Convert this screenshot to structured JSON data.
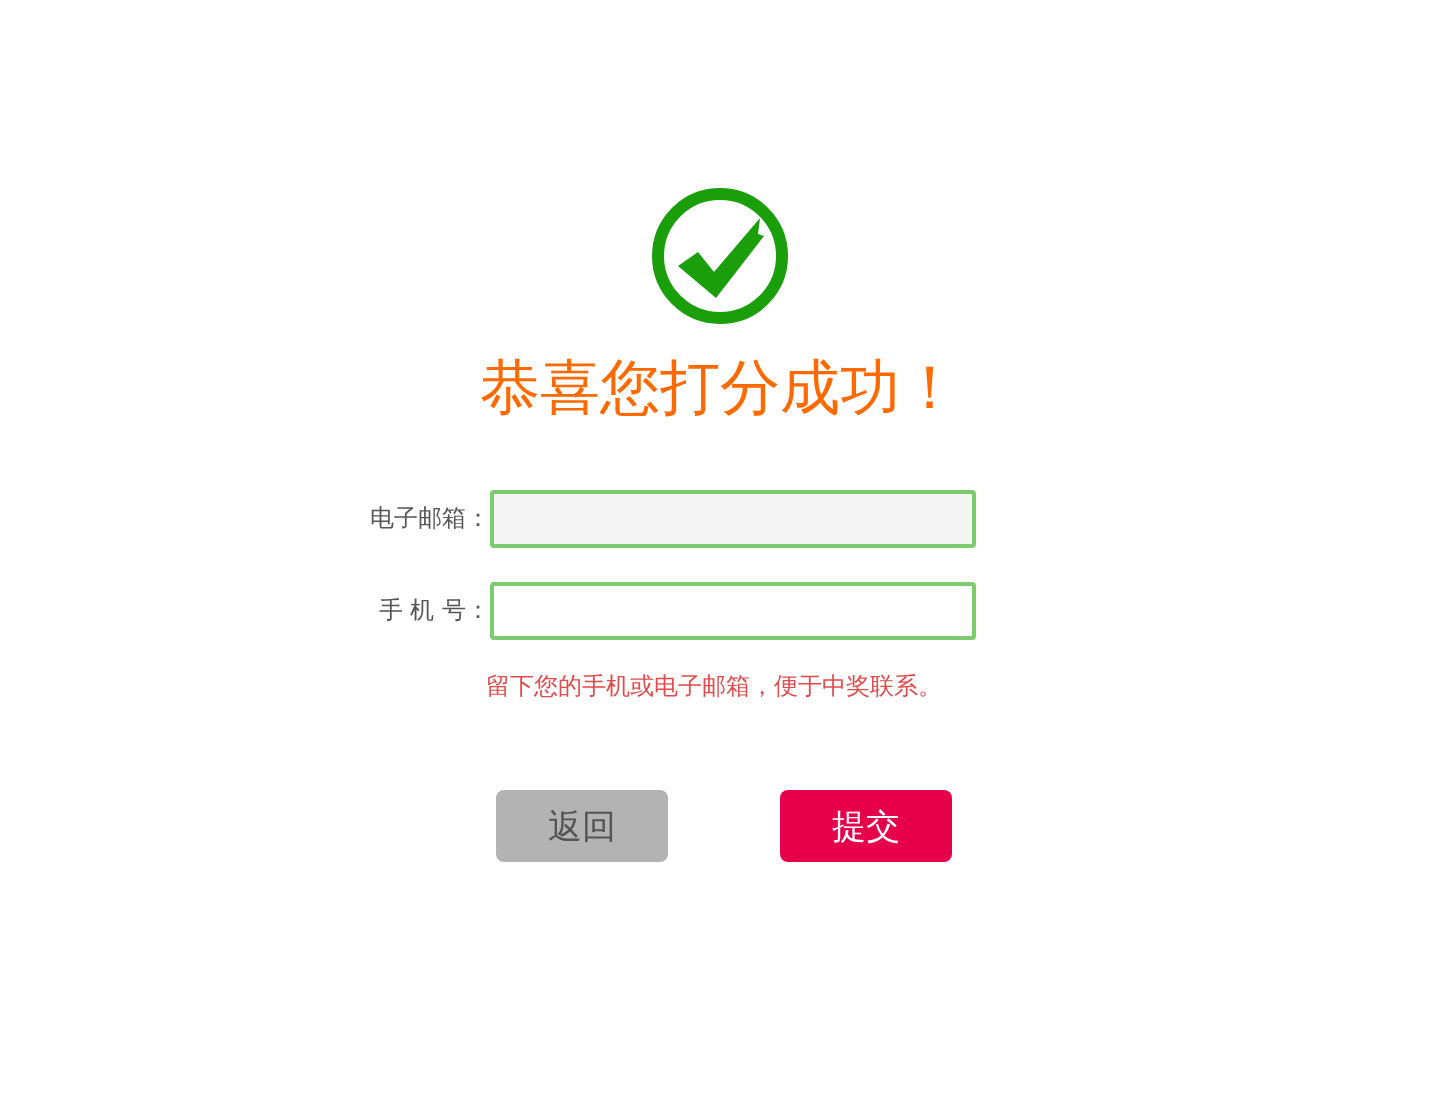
{
  "title": "恭喜您打分成功！",
  "fields": [
    {
      "label": "电子邮箱："
    },
    {
      "label": "手 机 号："
    }
  ],
  "hint": "留下您的手机或电子邮箱，便于中奖联系。",
  "buttons": [
    {
      "label": "返回",
      "kind": "secondary"
    },
    {
      "label": "提交",
      "kind": "primary"
    }
  ]
}
